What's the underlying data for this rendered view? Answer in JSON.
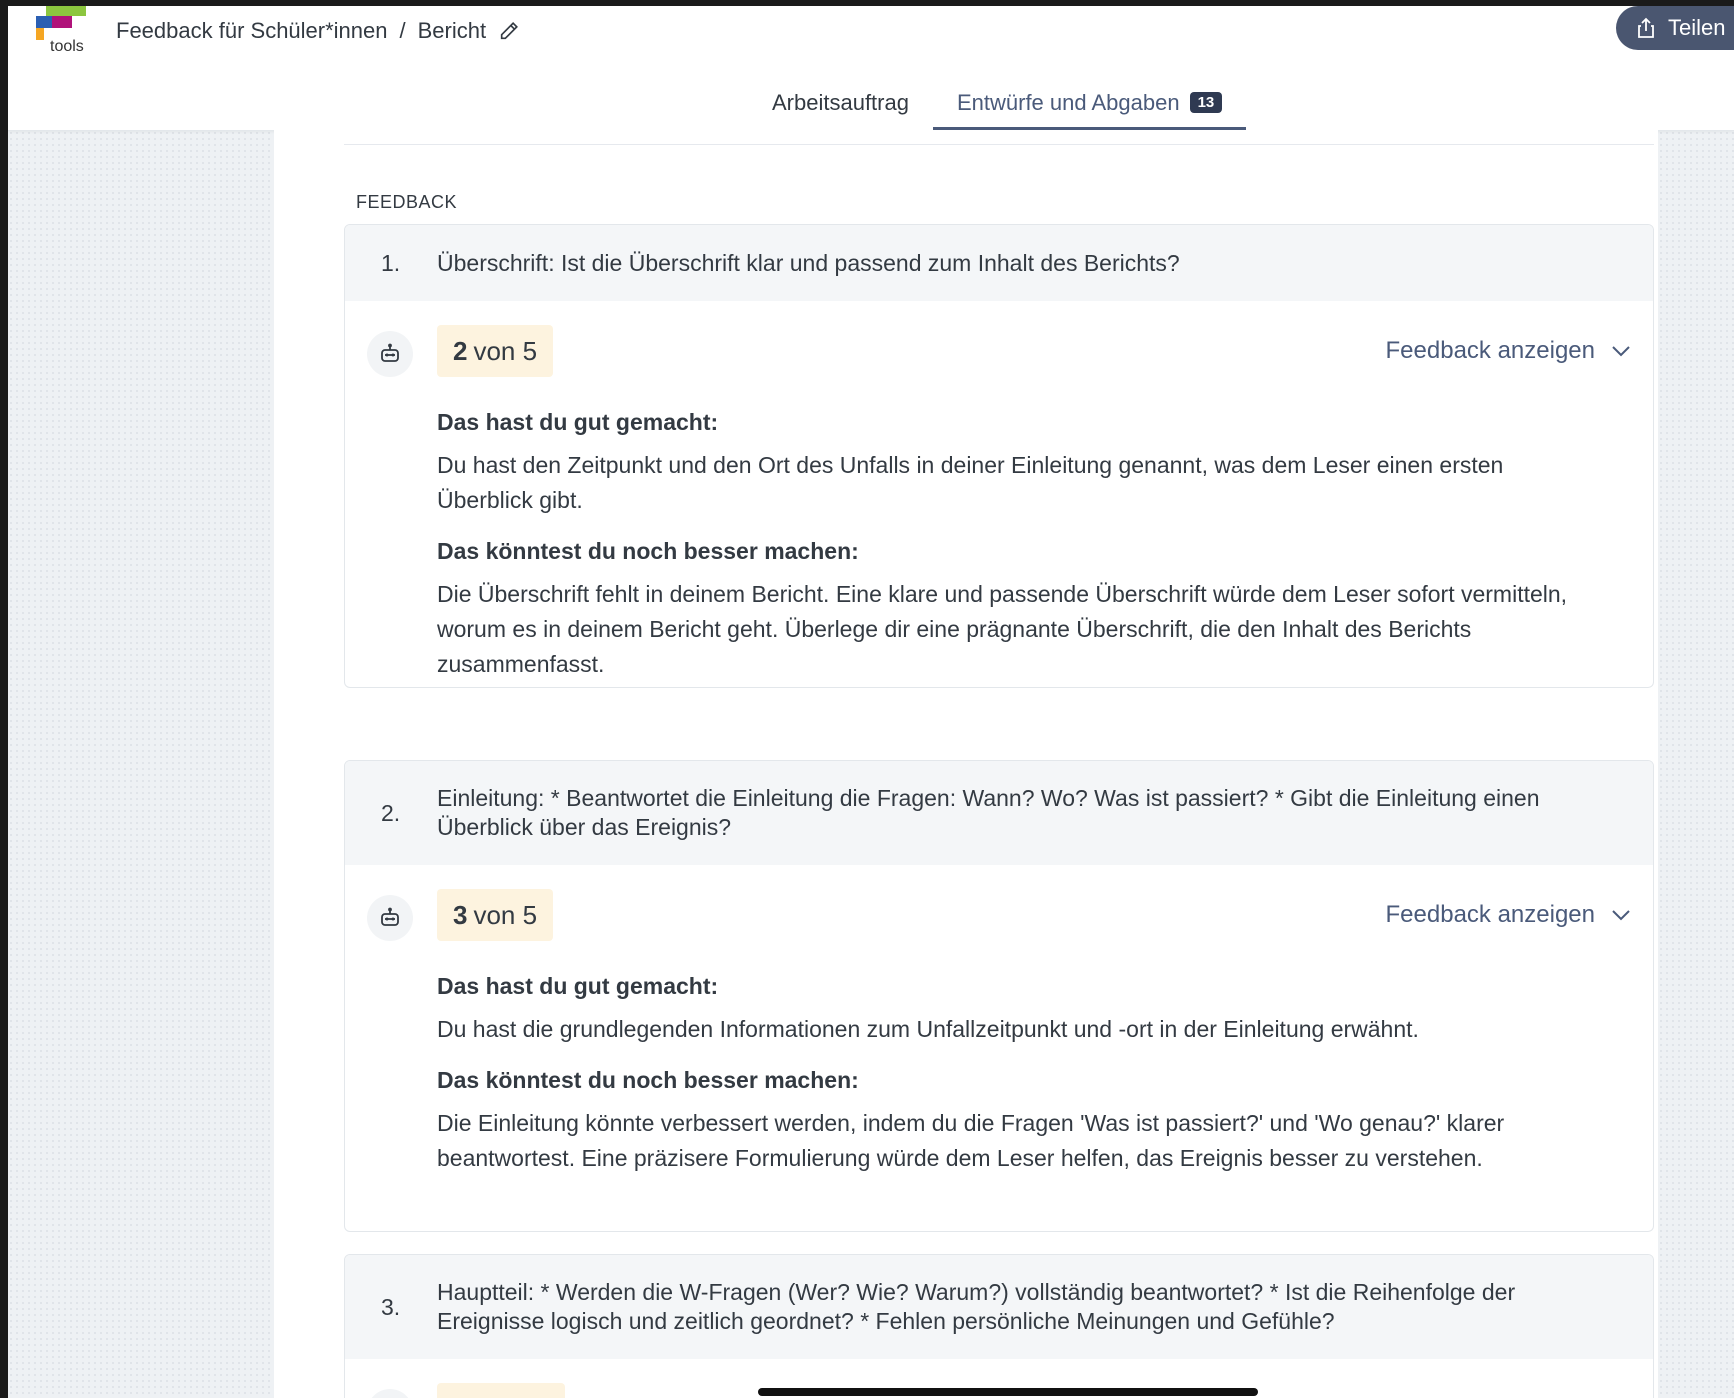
{
  "header": {
    "logo_text": "tools",
    "breadcrumb": [
      "Feedback für Schüler*innen",
      "Bericht"
    ],
    "breadcrumb_sep": "/",
    "share_label": "Teilen"
  },
  "tabs": [
    {
      "label": "Arbeitsauftrag",
      "active": false
    },
    {
      "label": "Entwürfe und Abgaben",
      "active": true,
      "badge": "13"
    }
  ],
  "section_title": "FEEDBACK",
  "cards": [
    {
      "num": "1.",
      "question": "Überschrift: Ist die Überschrift klar und passend zum Inhalt des Berichts?",
      "score": "2",
      "score_suffix": "von 5",
      "toggle": "Feedback anzeigen",
      "good_heading": "Das hast du gut gemacht:",
      "good_text": "Du hast den Zeitpunkt und den Ort des Unfalls in deiner Einleitung genannt, was dem Leser einen ersten Überblick gibt.",
      "improve_heading": "Das könntest du noch besser machen:",
      "improve_text": "Die Überschrift fehlt in deinem Bericht. Eine klare und passende Überschrift würde dem Leser sofort vermitteln, worum es in deinem Bericht geht. Überlege dir eine prägnante Überschrift, die den Inhalt des Berichts zusammenfasst."
    },
    {
      "num": "2.",
      "question": "Einleitung: * Beantwortet die Einleitung die Fragen: Wann? Wo? Was ist passiert? * Gibt die Einleitung einen Überblick über das Ereignis?",
      "score": "3",
      "score_suffix": "von 5",
      "toggle": "Feedback anzeigen",
      "good_heading": "Das hast du gut gemacht:",
      "good_text": "Du hast die grundlegenden Informationen zum Unfallzeitpunkt und -ort in der Einleitung erwähnt.",
      "improve_heading": "Das könntest du noch besser machen:",
      "improve_text": "Die Einleitung könnte verbessert werden, indem du die Fragen 'Was ist passiert?' und 'Wo genau?' klarer beantwortest. Eine präzisere Formulierung würde dem Leser helfen, das Ereignis besser zu verstehen."
    },
    {
      "num": "3.",
      "question": "Hauptteil: * Werden die W-Fragen (Wer? Wie? Warum?) vollständig beantwortet? * Ist die Reihenfolge der Ereignisse logisch und zeitlich geordnet? * Fehlen persönliche Meinungen und Gefühle?"
    }
  ],
  "colors": {
    "accent": "#4a5a7a",
    "share_bg": "#4a5670",
    "score_bg": "#fdf3df",
    "badge_bg": "#2f3a52"
  }
}
